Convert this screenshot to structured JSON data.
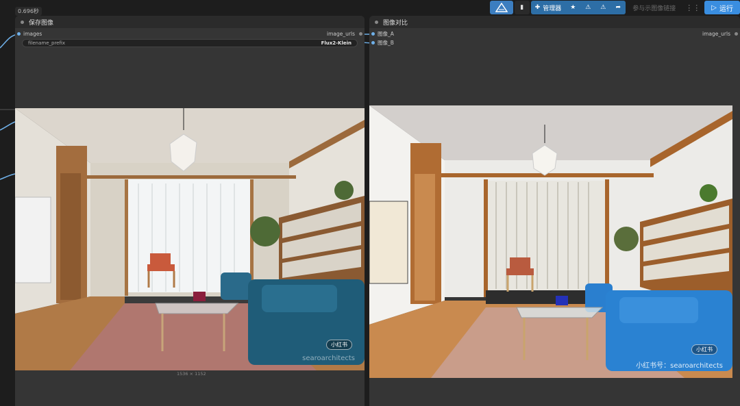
{
  "toolbar": {
    "timing": "0.696秒",
    "manager_label": "管理器",
    "hint_text": "参与示图像链接",
    "run_label": "运行",
    "accent": "#2d6ea6"
  },
  "save_node": {
    "title": "保存图像",
    "input_label": "images",
    "output_label": "image_urls",
    "widget_name": "filename_prefix",
    "widget_value": "Flux2-Klein",
    "image_size": "1536 × 1152",
    "watermark": "searoarchitects",
    "badge": "小红书"
  },
  "compare_node": {
    "title": "图像对比",
    "input_a": "图像_A",
    "input_b": "图像_B",
    "output_label": "image_urls",
    "watermark": "小红书号：searoarchitects",
    "badge": "小红书"
  }
}
